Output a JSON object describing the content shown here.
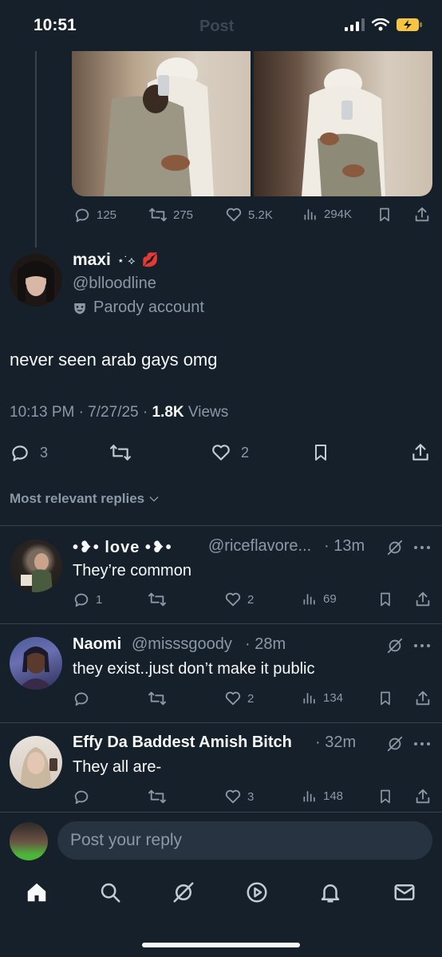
{
  "status": {
    "time": "10:51",
    "ghost_title": "Post"
  },
  "quoted": {
    "replies": "125",
    "reposts": "275",
    "likes": "5.2K",
    "views": "294K"
  },
  "tweet": {
    "name": "maxi",
    "name_deco": "⋆˙⟡",
    "name_emoji": "💋",
    "handle": "@blloodline",
    "badge": "Parody account",
    "text": "never seen arab gays omg",
    "time": "10:13 PM · 7/27/25 ·",
    "views_count": "1.8K",
    "views_label": "Views",
    "replies": "3",
    "likes": "2"
  },
  "sort_label": "Most relevant replies",
  "replies": [
    {
      "name": "•❥• love •❥•",
      "handle": "@riceflavore...",
      "time": "· 13m",
      "text": "They’re common",
      "replies": "1",
      "likes": "2",
      "views": "69"
    },
    {
      "name": "Naomi",
      "handle": "@misssgoody",
      "time": "· 28m",
      "text": "they exist..just don’t make it public",
      "replies": "",
      "likes": "2",
      "views": "134"
    },
    {
      "name": "Effy Da Baddest Amish Bitch",
      "handle": "",
      "time": "· 32m",
      "text": "They all are-",
      "replies": "",
      "likes": "3",
      "views": "148"
    }
  ],
  "composer": {
    "placeholder": "Post your reply"
  },
  "icons": [
    "reply-icon",
    "repost-icon",
    "like-icon",
    "views-icon",
    "bookmark-icon",
    "share-icon",
    "grok-icon",
    "more-icon",
    "home-icon",
    "search-icon",
    "video-icon",
    "bell-icon",
    "mail-icon"
  ]
}
